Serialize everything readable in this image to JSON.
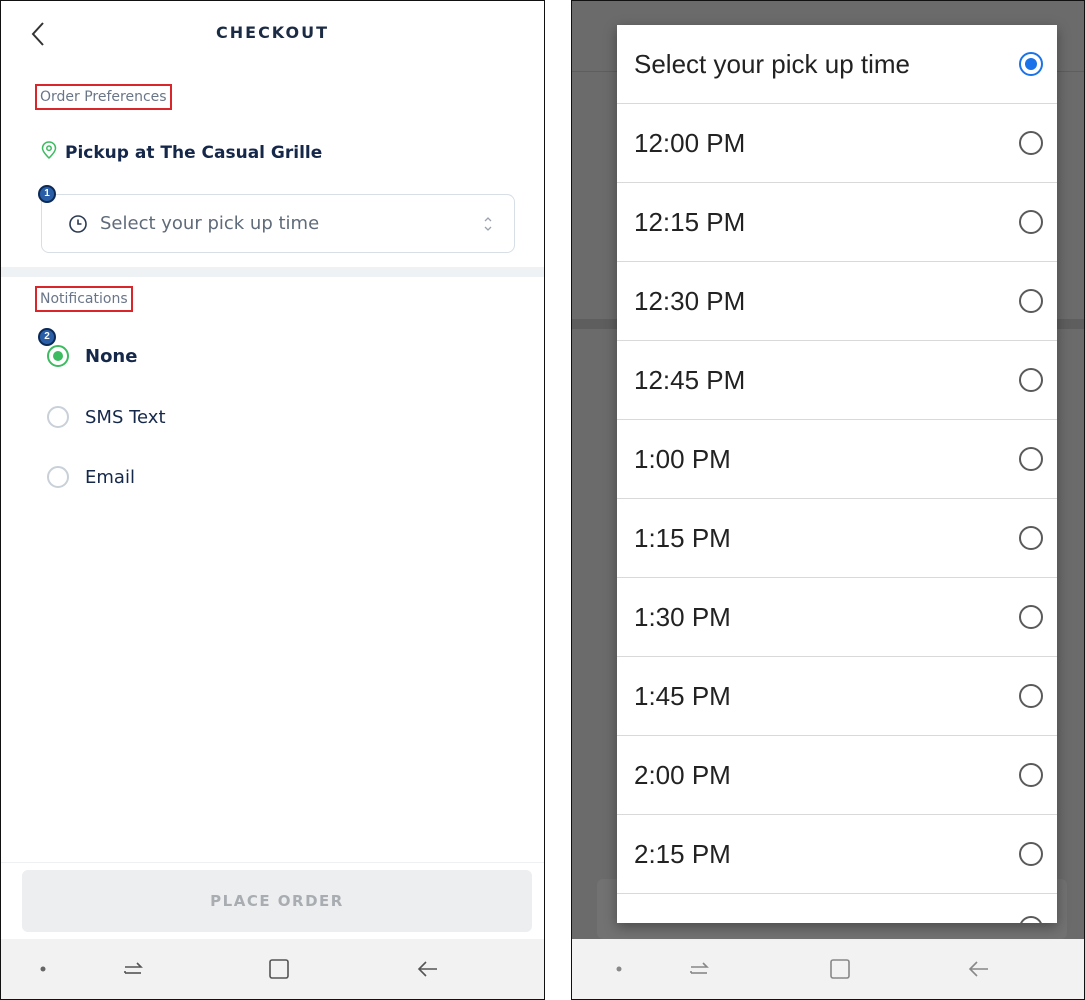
{
  "left_screen": {
    "header": {
      "title": "CHECKOUT"
    },
    "order_preferences": {
      "section_label": "Order Preferences",
      "pickup_text": "Pickup at The Casual Grille",
      "badge": "1",
      "time_select_placeholder": "Select your pick up time"
    },
    "notifications": {
      "section_label": "Notifications",
      "badge": "2",
      "options": [
        {
          "label": "None",
          "checked": true
        },
        {
          "label": "SMS Text",
          "checked": false
        },
        {
          "label": "Email",
          "checked": false
        }
      ]
    },
    "place_order_label": "PLACE ORDER"
  },
  "right_screen": {
    "dialog": {
      "title": "Select your pick up time",
      "options": [
        "12:00 PM",
        "12:15 PM",
        "12:30 PM",
        "12:45 PM",
        "1:00 PM",
        "1:15 PM",
        "1:30 PM",
        "1:45 PM",
        "2:00 PM",
        "2:15 PM"
      ]
    }
  },
  "colors": {
    "accent_green": "#3dbb61",
    "dialog_radio_blue": "#1a73e8",
    "annotation_red": "#d9262b",
    "badge_blue": "#2a5fa8"
  }
}
